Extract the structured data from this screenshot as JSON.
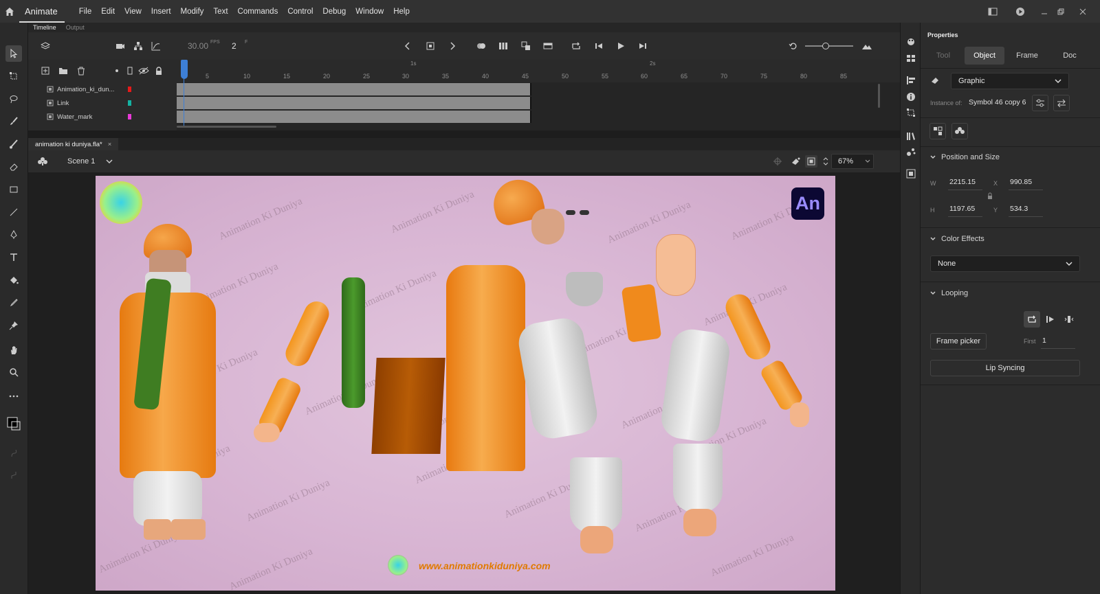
{
  "app": {
    "name": "Animate"
  },
  "menu": [
    "File",
    "Edit",
    "View",
    "Insert",
    "Modify",
    "Text",
    "Commands",
    "Control",
    "Debug",
    "Window",
    "Help"
  ],
  "panel_tabs": {
    "timeline": "Timeline",
    "output": "Output"
  },
  "timeline": {
    "fps": "30.00",
    "fps_unit": "FPS",
    "frame": "2",
    "frame_unit": "F",
    "ruler_numbers": [
      "5",
      "10",
      "15",
      "20",
      "25",
      "30",
      "35",
      "40",
      "45",
      "50",
      "55",
      "60",
      "65",
      "70",
      "75",
      "80",
      "85"
    ],
    "second_marks": [
      "1s",
      "2s"
    ],
    "layers": [
      {
        "name": "Animation_ki_dun...",
        "color": "#e51a1a"
      },
      {
        "name": "Link",
        "color": "#14b3a3"
      },
      {
        "name": "Water_mark",
        "color": "#e83ad8"
      }
    ]
  },
  "document": {
    "tab": "animation ki duniya.fla*",
    "close": "×"
  },
  "scene": {
    "name": "Scene 1",
    "zoom": "67%"
  },
  "stage": {
    "watermark_text": "Animation Ki Duniya",
    "website": "www.animationkiduniya.com",
    "badge": "An"
  },
  "properties": {
    "title": "Properties",
    "tabs": [
      "Tool",
      "Object",
      "Frame",
      "Doc"
    ],
    "symbol_type": "Graphic",
    "instance_of_label": "Instance of:",
    "instance_of": "Symbol 46 copy 6",
    "position_and_size": {
      "header": "Position and Size",
      "w_label": "W",
      "w": "2215.15",
      "x_label": "X",
      "x": "990.85",
      "h_label": "H",
      "h": "1197.65",
      "y_label": "Y",
      "y": "534.3"
    },
    "color_effects": {
      "header": "Color Effects",
      "value": "None"
    },
    "looping": {
      "header": "Looping",
      "frame_picker": "Frame picker",
      "first_label": "First",
      "first": "1",
      "lip_syncing": "Lip Syncing"
    }
  },
  "colors": {
    "accent": "#3d7fd6",
    "stage_bg": "#d8b5d3",
    "website": "#e07a00",
    "badge_bg": "#0c0833"
  }
}
